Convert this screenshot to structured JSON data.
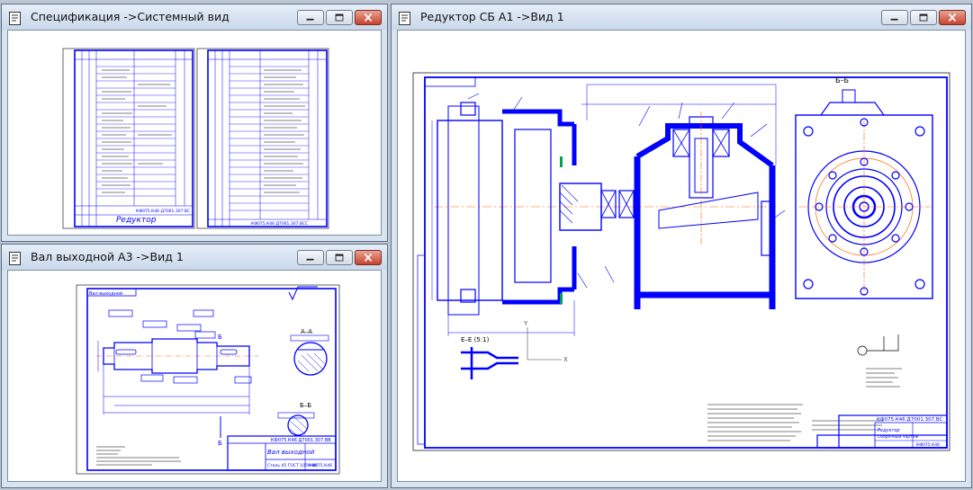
{
  "windows": {
    "spec": {
      "title": "Спецификация ->Системный вид",
      "stamp_code_left": "КФ075.К46 Д7001.307.ВС",
      "stamp_name": "Редуктор",
      "stamp_code_right": "КФ075.К46 Д7001.307.ВСС"
    },
    "shaft": {
      "title": "Вал выходной А3 ->Вид 1",
      "frame_label": "Вал выходной",
      "section_a": "А–А",
      "section_b": "Б–Б",
      "stamp_code": "КФ075.К46 Д7001.307.ВВ",
      "stamp_name": "Вал выходной",
      "stamp_material": "Сталь 45 ГОСТ 1050-88",
      "stamp_org": "КФ075.К46"
    },
    "reducer": {
      "title": "Редуктор СБ А1 ->Вид 1",
      "section_bb": "Б–Б",
      "detail_label": "Е–Е (5:1)",
      "axis_x": "X",
      "axis_y": "Y",
      "stamp_code": "КФ075.К46 Д7001.307.ВС",
      "stamp_name": "Редуктор",
      "stamp_sub": "Сборочный чертеж",
      "stamp_org": "КФ075.К46"
    }
  },
  "window_controls": {
    "minimize": "minimize",
    "maximize": "maximize",
    "close": "close"
  },
  "colors": {
    "line": "#0000ff",
    "hatch": "#0000ff",
    "axis": "#ff6600",
    "titlebar": "#d3e0ef",
    "close": "#c7432e"
  }
}
